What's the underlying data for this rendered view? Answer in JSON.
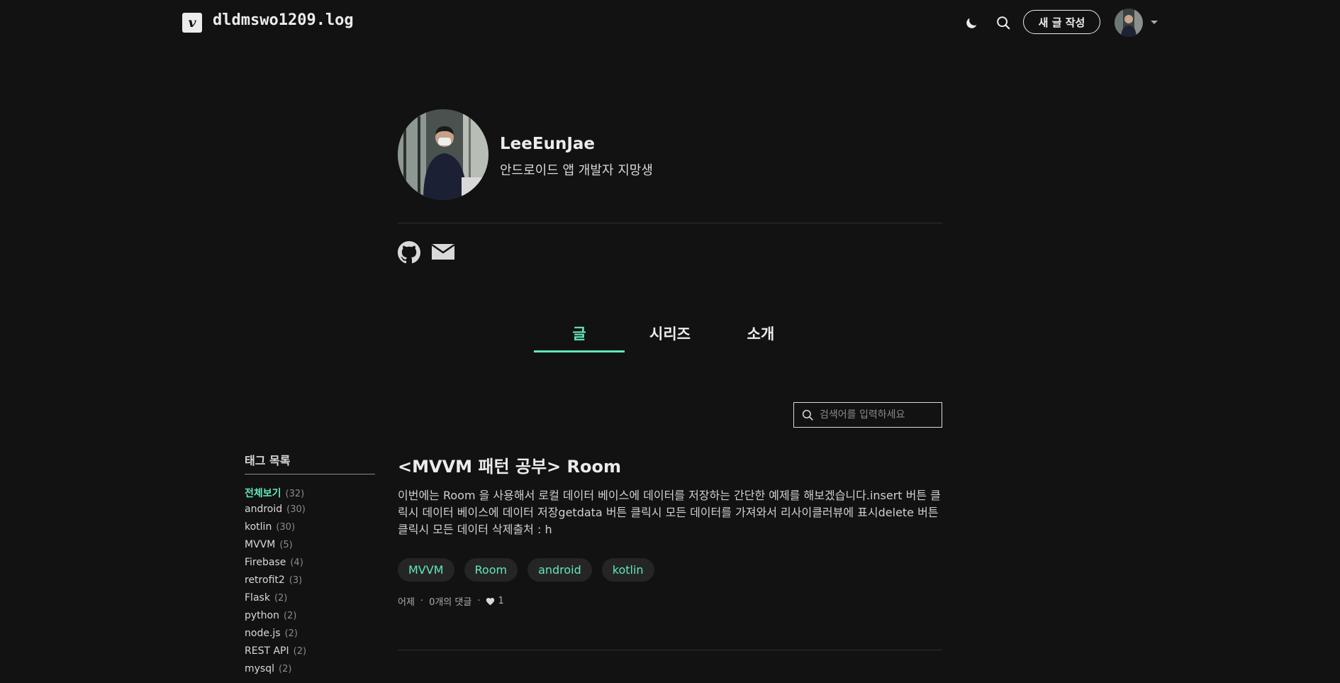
{
  "header": {
    "logo_letter": "v",
    "blog_title": "dldmswo1209.log",
    "new_post_label": "새 글 작성"
  },
  "profile": {
    "name": "LeeEunJae",
    "description": "안드로이드 앱 개발자 지망생"
  },
  "tabs": [
    {
      "label": "글",
      "active": true
    },
    {
      "label": "시리즈",
      "active": false
    },
    {
      "label": "소개",
      "active": false
    }
  ],
  "search": {
    "placeholder": "검색어를 입력하세요"
  },
  "tag_panel": {
    "title": "태그 목록",
    "tags": [
      {
        "name": "전체보기",
        "count": "(32)",
        "active": true
      },
      {
        "name": "android",
        "count": "(30)"
      },
      {
        "name": "kotlin",
        "count": "(30)"
      },
      {
        "name": "MVVM",
        "count": "(5)"
      },
      {
        "name": "Firebase",
        "count": "(4)"
      },
      {
        "name": "retrofit2",
        "count": "(3)"
      },
      {
        "name": "Flask",
        "count": "(2)"
      },
      {
        "name": "python",
        "count": "(2)"
      },
      {
        "name": "node.js",
        "count": "(2)"
      },
      {
        "name": "REST API",
        "count": "(2)"
      },
      {
        "name": "mysql",
        "count": "(2)"
      }
    ]
  },
  "post": {
    "title": "<MVVM 패턴 공부> Room",
    "summary": "이번에는 Room 을 사용해서 로컬 데이터 베이스에 데이터를 저장하는 간단한 예제를 해보겠습니다.insert 버튼 클릭시 데이터 베이스에 데이터 저장getdata 버튼 클릭시 모든 데이터를 가져와서 리사이클러뷰에 표시delete 버튼 클릭시 모든 데이터 삭제출처 : h",
    "tags": [
      "MVVM",
      "Room",
      "android",
      "kotlin"
    ],
    "date": "어제",
    "comments": "0개의 댓글",
    "likes": "1"
  },
  "colors": {
    "background": "#121212",
    "accent": "#63e6be",
    "text": "#ececec"
  }
}
